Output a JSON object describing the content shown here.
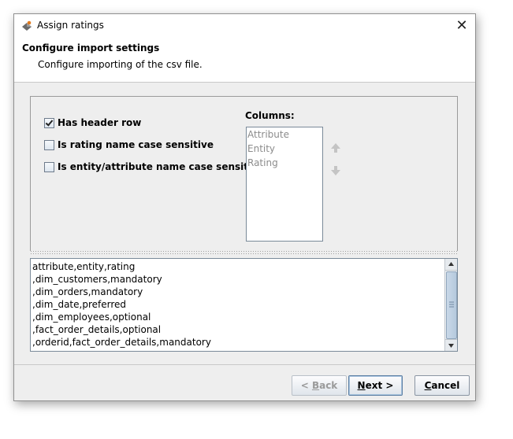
{
  "window": {
    "title": "Assign ratings",
    "close_symbol": "✕"
  },
  "header": {
    "title": "Configure import settings",
    "subtitle": "Configure importing of the csv file."
  },
  "options": [
    {
      "label": "Has header row",
      "checked": true
    },
    {
      "label": "Is rating name case sensitive",
      "checked": false
    },
    {
      "label": "Is entity/attribute name case sensitive",
      "checked": false
    }
  ],
  "columns": {
    "label": "Columns:",
    "items": [
      "Attribute",
      "Entity",
      "Rating"
    ],
    "move_up_icon": "arrow-up-icon",
    "move_down_icon": "arrow-down-icon"
  },
  "csv_preview": [
    "attribute,entity,rating",
    ",dim_customers,mandatory",
    ",dim_orders,mandatory",
    ",dim_date,preferred",
    ",dim_employees,optional",
    ",fact_order_details,optional",
    ",orderid,fact_order_details,mandatory"
  ],
  "buttons": {
    "back": {
      "mnemonic_prefix": "< ",
      "mnemonic": "B",
      "rest": "ack",
      "enabled": false
    },
    "next": {
      "mnemonic": "N",
      "rest": "ext >",
      "enabled": true
    },
    "cancel": {
      "mnemonic": "C",
      "rest": "ancel",
      "enabled": true
    }
  }
}
